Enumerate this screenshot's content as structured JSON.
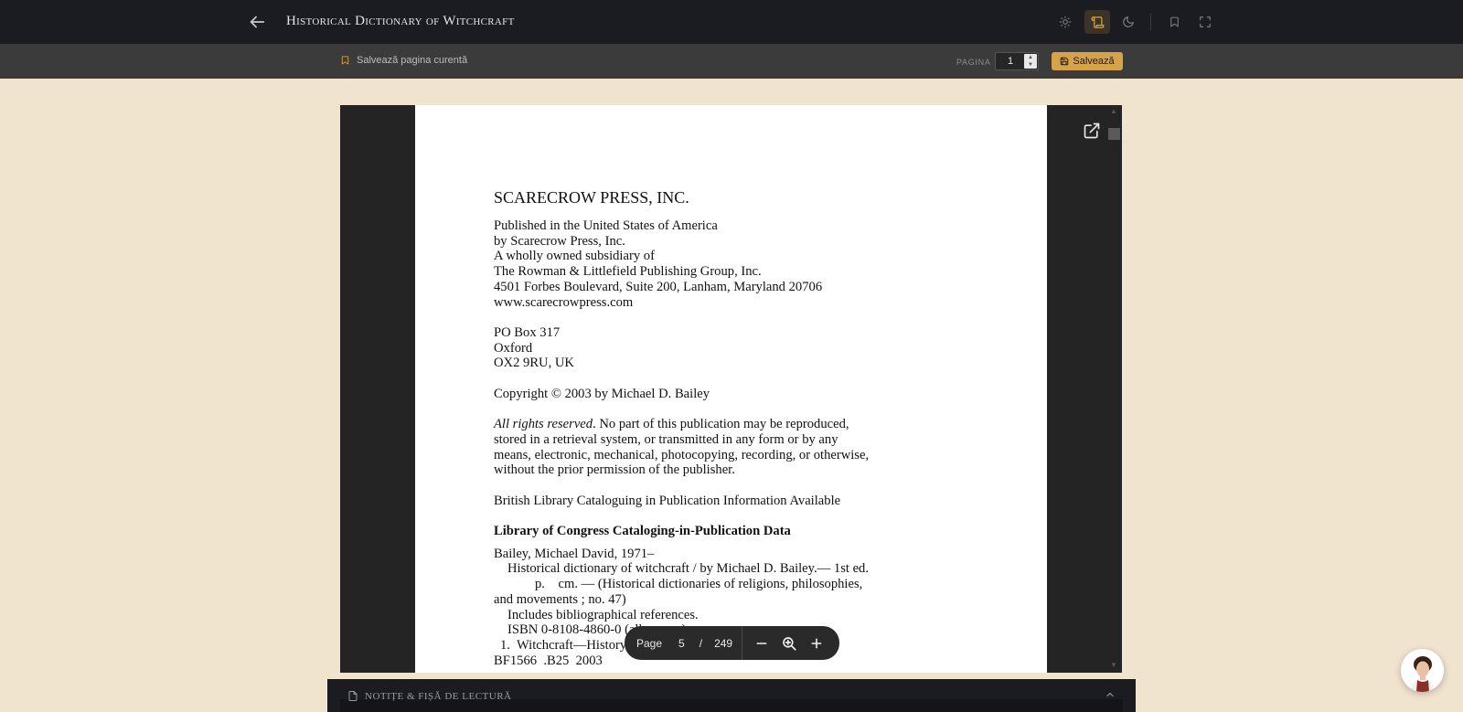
{
  "header": {
    "book_title": "Historical Dictionary of Witchcraft",
    "icons": [
      "arrow-left-icon",
      "sun-icon",
      "scroll-icon",
      "moon-icon",
      "bookmark-icon",
      "fullscreen-icon"
    ],
    "active_tool": "scroll-icon",
    "accent_color": "#d6a24a"
  },
  "subbar": {
    "save_current_label": "Salvează pagina curentă",
    "page_label": "PAGINA",
    "page_value": "1",
    "save_button_label": "Salvează"
  },
  "pdf": {
    "publisher": "SCARECROW PRESS, INC.",
    "address": [
      "Published in the United States of America",
      "by Scarecrow Press, Inc.",
      "A wholly owned subsidiary of",
      "The Rowman & Littlefield Publishing Group, Inc.",
      "4501 Forbes Boulevard, Suite 200, Lanham, Maryland 20706",
      "www.scarecrowpress.com"
    ],
    "uk_address": [
      "PO Box 317",
      "Oxford",
      "OX2 9RU, UK"
    ],
    "copyright": "Copyright © 2003 by Michael D. Bailey",
    "rights_italic": "All rights reserved",
    "rights_rest_1": ". No part of this publication may be reproduced,",
    "rights_lines": [
      "stored in a retrieval system, or transmitted in any form or by any",
      "means, electronic, mechanical, photocopying, recording, or otherwise,",
      "without the prior permission of the publisher."
    ],
    "british_library": "British Library Cataloguing in Publication Information Available",
    "loc_heading": "Library of Congress Cataloging-in-Publication Data",
    "cip": {
      "author": "Bailey, Michael David, 1971–",
      "title_line": "Historical dictionary of witchcraft / by Michael D. Bailey.— 1st ed.",
      "pages_line": "p.    cm. — (Historical dictionaries of religions, philosophies,",
      "series_line": "and movements ; no. 47)",
      "includes": "Includes bibliographical references.",
      "isbn": "ISBN 0-8108-4860-0 (alk. paper)",
      "subjects": "1.  Witchcraft—History—Dictionaries.   I.  Title.   II. Series.",
      "classification": "BF1566  .B25  2003"
    }
  },
  "zoom_toolbar": {
    "page_label": "Page",
    "current_page": "5",
    "separator": "/",
    "total_pages": "249"
  },
  "notes": {
    "label": "NOTIȚE & FIȘĂ DE LECTURĂ"
  }
}
